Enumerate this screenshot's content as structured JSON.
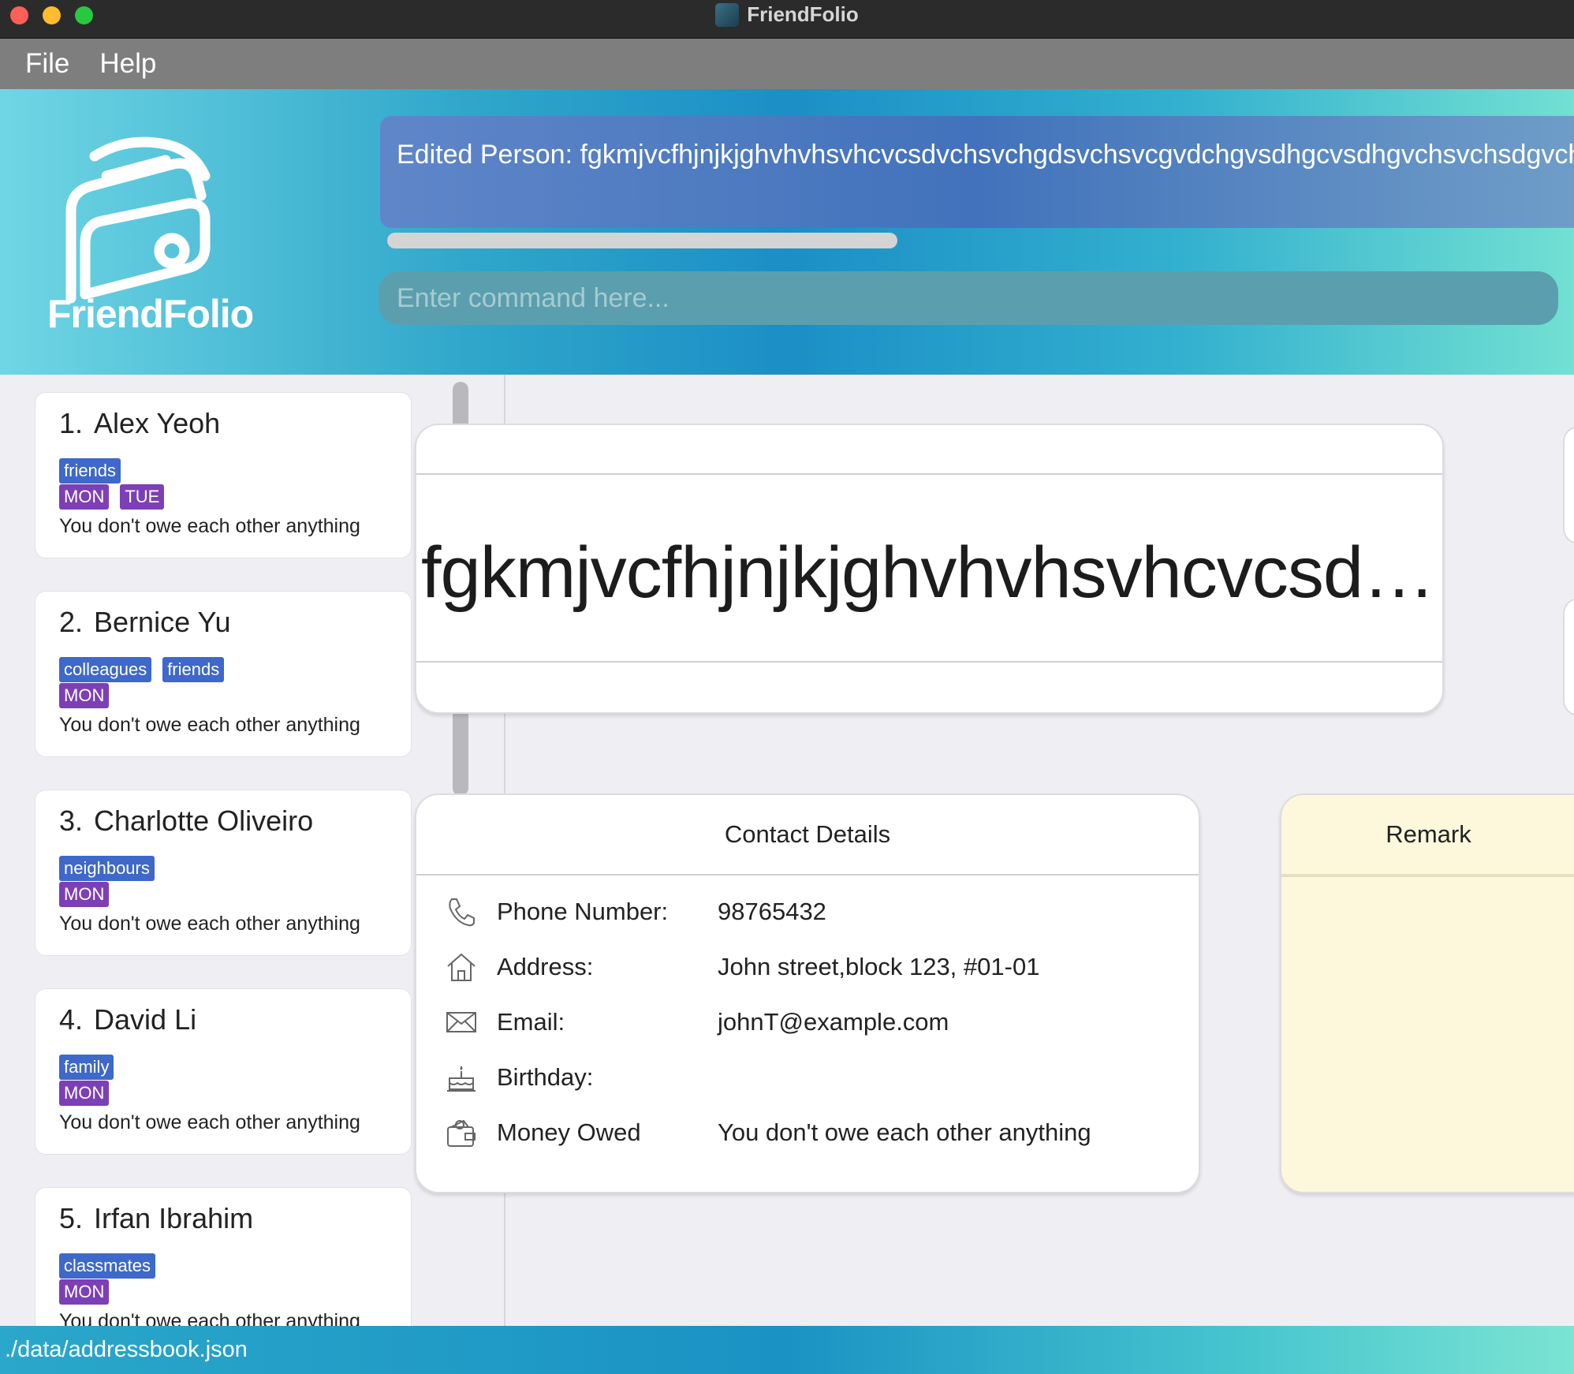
{
  "window": {
    "title": "FriendFolio"
  },
  "menu": {
    "file": "File",
    "help": "Help"
  },
  "header": {
    "logo_text": "FriendFolio",
    "result": "Edited Person: fgkmjvcfhjnjkjghvhvhsvhcvcsdvchsvchgdsvchsvcgvdchgvsdhgcvsdhgvchsvchsdgvch",
    "command_placeholder": "Enter command here..."
  },
  "persons": [
    {
      "index": "1.",
      "name": "Alex Yeoh",
      "tags": [
        "friends"
      ],
      "days": [
        "MON",
        "TUE"
      ],
      "owe": "You don't owe each other anything"
    },
    {
      "index": "2.",
      "name": "Bernice Yu",
      "tags": [
        "colleagues",
        "friends"
      ],
      "days": [
        "MON"
      ],
      "owe": "You don't owe each other anything"
    },
    {
      "index": "3.",
      "name": "Charlotte Oliveiro",
      "tags": [
        "neighbours"
      ],
      "days": [
        "MON"
      ],
      "owe": "You don't owe each other anything"
    },
    {
      "index": "4.",
      "name": "David Li",
      "tags": [
        "family"
      ],
      "days": [
        "MON"
      ],
      "owe": "You don't owe each other anything"
    },
    {
      "index": "5.",
      "name": "Irfan Ibrahim",
      "tags": [
        "classmates"
      ],
      "days": [
        "MON"
      ],
      "owe": "You don't owe each other anything"
    }
  ],
  "detail": {
    "name": "fgkmjvcfhjnjkjghvhvhsvhcvcsdvchsvchgdsvchsvcgvdchgvsdhgcvsdhgvchsvchsdgvch",
    "contact_title": "Contact Details",
    "rows": [
      {
        "icon": "phone-icon",
        "label": "Phone Number:",
        "value": "98765432"
      },
      {
        "icon": "home-icon",
        "label": "Address:",
        "value": "John street,block 123, #01-01"
      },
      {
        "icon": "mail-icon",
        "label": "Email:",
        "value": "johnT@example.com"
      },
      {
        "icon": "cake-icon",
        "label": "Birthday:",
        "value": ""
      },
      {
        "icon": "wallet-icon",
        "label": "Money Owed",
        "value": "You don't owe each other anything"
      }
    ],
    "remark_title": "Remark"
  },
  "status": {
    "path": "./data/addressbook.json"
  },
  "colors": {
    "tag": "#3e68c9",
    "day": "#7d3fb5",
    "remark_bg": "#fdf7dc"
  }
}
